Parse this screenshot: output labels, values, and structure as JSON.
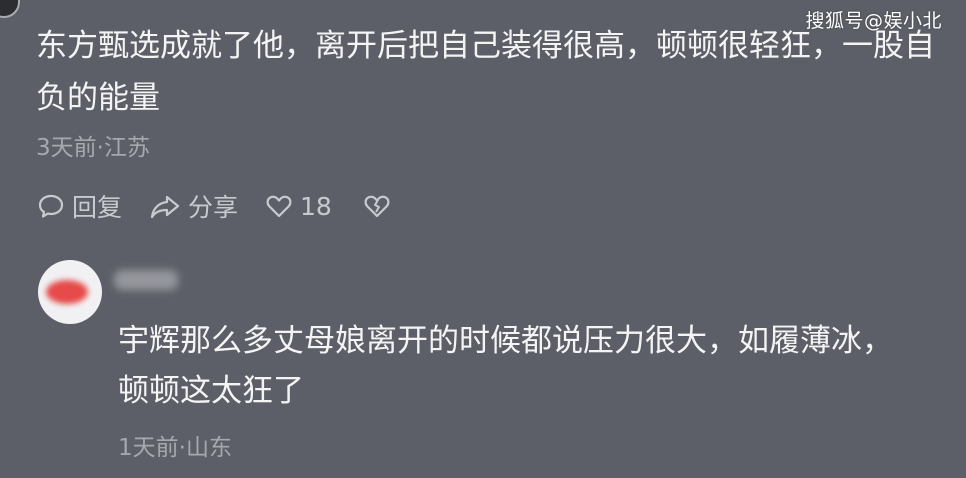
{
  "watermark": "搜狐号@娱小北",
  "comment": {
    "text": "东方甄选成就了他，离开后把自己装得很高，顿顿很轻狂，一股自负的能量",
    "meta": "3天前·江苏",
    "actions": {
      "reply_label": "回复",
      "share_label": "分享",
      "like_count": "18"
    }
  },
  "reply": {
    "text": "宇辉那么多丈母娘离开的时候都说压力很大，如履薄冰，顿顿这太狂了",
    "meta": "1天前·山东"
  }
}
